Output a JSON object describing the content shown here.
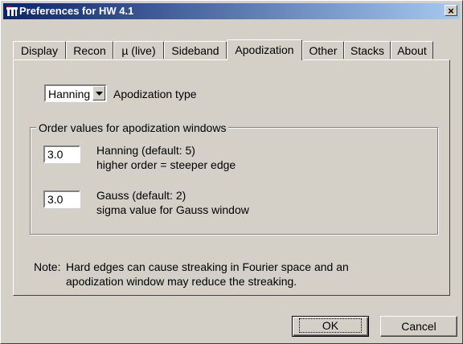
{
  "window": {
    "title": "Preferences for HW 4.1",
    "close_label": "×"
  },
  "tabs": [
    {
      "label": "Display",
      "active": false
    },
    {
      "label": "Recon",
      "active": false
    },
    {
      "label": "µ (live)",
      "active": false
    },
    {
      "label": "Sideband",
      "active": false
    },
    {
      "label": "Apodization",
      "active": true
    },
    {
      "label": "Other",
      "active": false
    },
    {
      "label": "Stacks",
      "active": false
    },
    {
      "label": "About",
      "active": false
    }
  ],
  "apodization": {
    "type_value": "Hanning",
    "type_label": "Apodization type",
    "group_label": "Order values for apodization windows",
    "hanning": {
      "value": "3.0",
      "line1": "Hanning  (default: 5)",
      "line2": "higher order = steeper edge"
    },
    "gauss": {
      "value": "3.0",
      "line1": "Gauss  (default: 2)",
      "line2": "sigma value for Gauss window"
    },
    "note_label": "Note:",
    "note_line1": "Hard edges can cause streaking in Fourier space and an",
    "note_line2": "apodization window may reduce the streaking."
  },
  "buttons": {
    "ok": "OK",
    "cancel": "Cancel"
  },
  "icons": {
    "app": "window-app-icon",
    "dropdown": "chevron-down-icon"
  }
}
